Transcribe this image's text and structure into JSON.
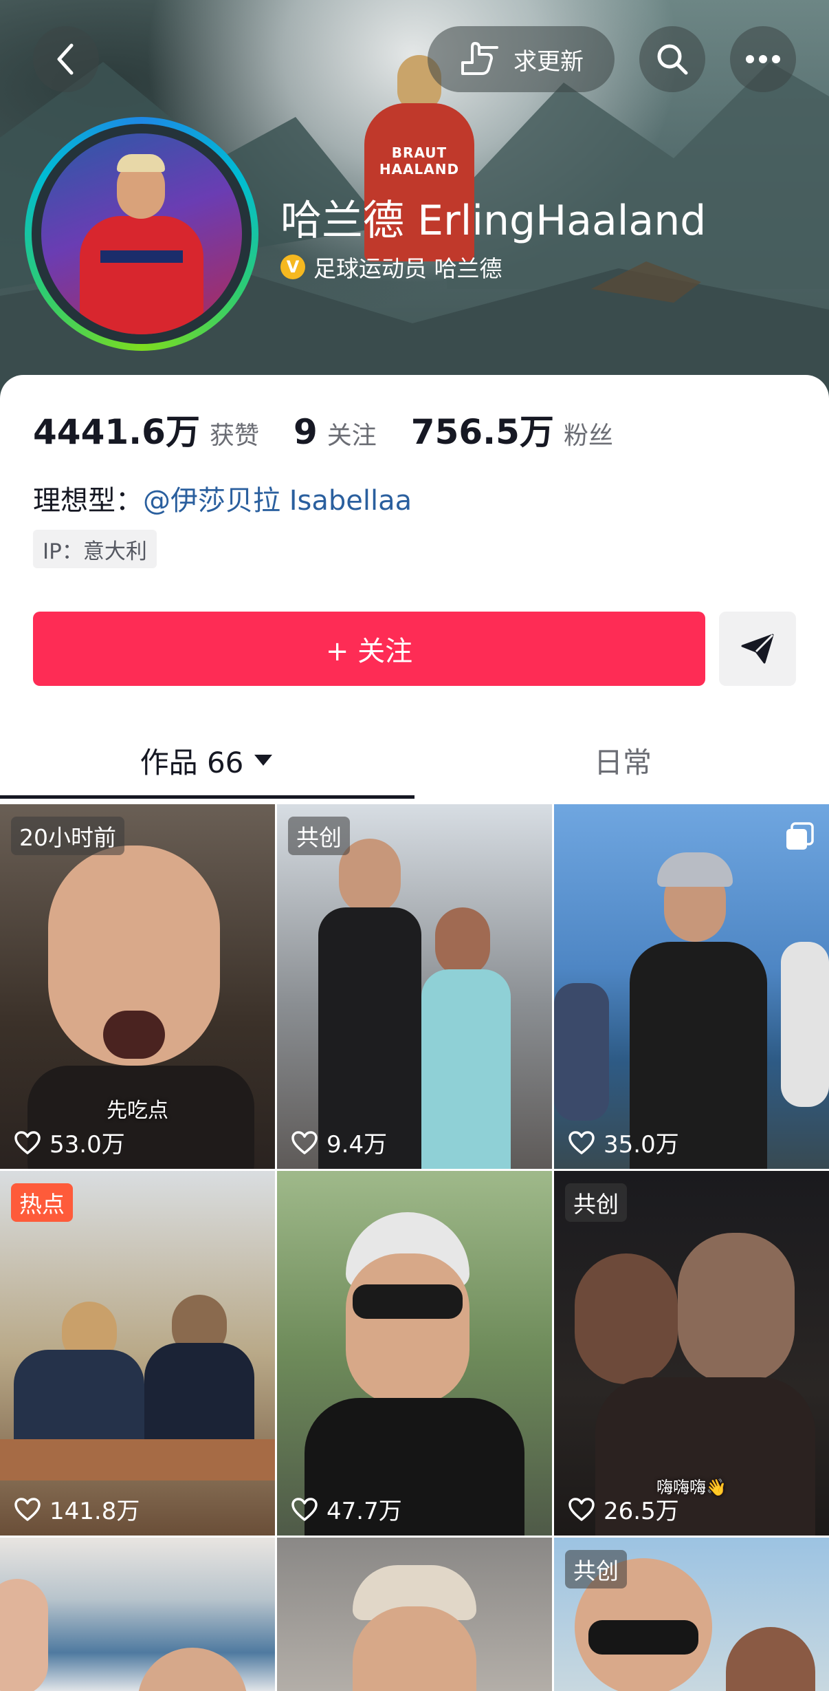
{
  "header": {
    "update_label": "求更新",
    "jersey_text": "BRAUT HAALAND",
    "name": "哈兰德 ErlingHaaland",
    "verify_badge": "V",
    "verify_text": "足球运动员 哈兰德"
  },
  "stats": [
    {
      "value": "4441.6万",
      "label": "获赞"
    },
    {
      "value": "9",
      "label": "关注"
    },
    {
      "value": "756.5万",
      "label": "粉丝"
    }
  ],
  "ideal": {
    "label": "理想型：",
    "link": "@伊莎贝拉 Isabellaa"
  },
  "ip": "IP：意大利",
  "follow_label": "+ 关注",
  "tabs": {
    "works": "作品 66",
    "daily": "日常"
  },
  "videos": [
    {
      "badge": "20小时前",
      "likes": "53.0万",
      "caption": "先吃点",
      "icon": "heart-icon"
    },
    {
      "badge": "共创",
      "likes": "9.4万",
      "icon": "heart-icon"
    },
    {
      "badge": "",
      "likes": "35.0万",
      "icon": "heart-icon",
      "multi": true
    },
    {
      "badge": "热点",
      "likes": "141.8万",
      "icon": "heart-icon"
    },
    {
      "badge": "",
      "likes": "47.7万",
      "icon": "heart-icon"
    },
    {
      "badge": "共创",
      "likes": "26.5万",
      "caption": "嗨嗨嗨👋",
      "icon": "heart-icon"
    },
    {
      "badge": "",
      "likes": "",
      "icon": ""
    },
    {
      "badge": "",
      "likes": "",
      "icon": ""
    },
    {
      "badge": "共创",
      "likes": "",
      "icon": ""
    }
  ],
  "colors": {
    "primary": "#fe2c55",
    "link": "#2a5f9e",
    "verify": "#f5b820",
    "hot": "#fe5b3a"
  }
}
